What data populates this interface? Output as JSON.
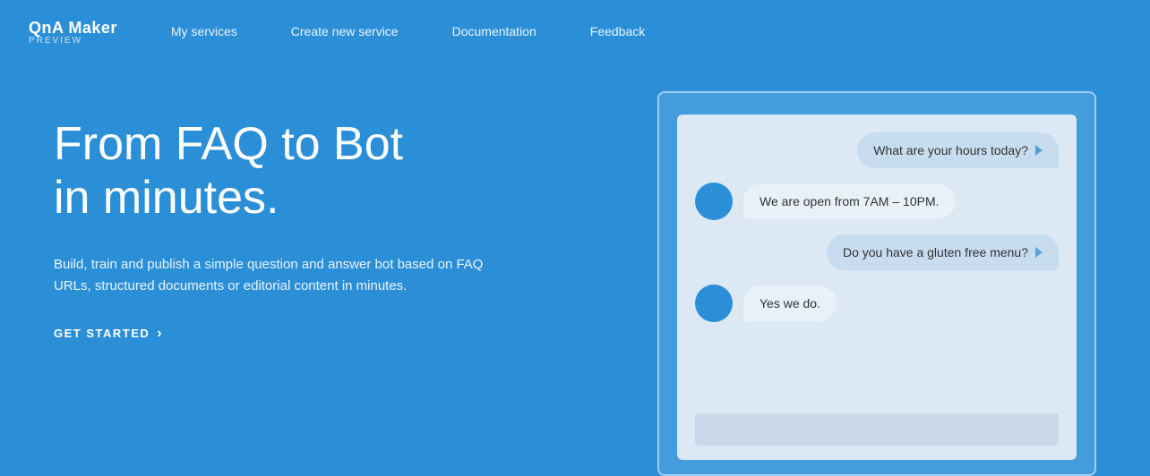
{
  "brand": {
    "title": "QnA Maker",
    "subtitle": "PREVIEW"
  },
  "nav": {
    "links": [
      {
        "label": "My services",
        "id": "my-services"
      },
      {
        "label": "Create new service",
        "id": "create-new-service"
      },
      {
        "label": "Documentation",
        "id": "documentation"
      },
      {
        "label": "Feedback",
        "id": "feedback"
      }
    ]
  },
  "hero": {
    "headline": "From FAQ to Bot\nin minutes.",
    "description": "Build, train and publish a simple question and answer bot based on FAQ URLs, structured documents or editorial content in minutes.",
    "cta_label": "GET STARTED"
  },
  "chat": {
    "messages": [
      {
        "type": "outgoing",
        "text": "What are your hours today?",
        "id": "msg1"
      },
      {
        "type": "incoming",
        "text": "We are open from 7AM – 10PM.",
        "id": "msg2"
      },
      {
        "type": "outgoing",
        "text": "Do you have a gluten free menu?",
        "id": "msg3"
      },
      {
        "type": "incoming",
        "text": "Yes we do.",
        "id": "msg4"
      }
    ]
  },
  "colors": {
    "bg": "#2B8FD8",
    "avatar": "#2B8FD8",
    "chat_bg": "#dce9f5",
    "outgoing_bubble": "#c8dcf0",
    "incoming_bubble": "#e8f0f8"
  }
}
